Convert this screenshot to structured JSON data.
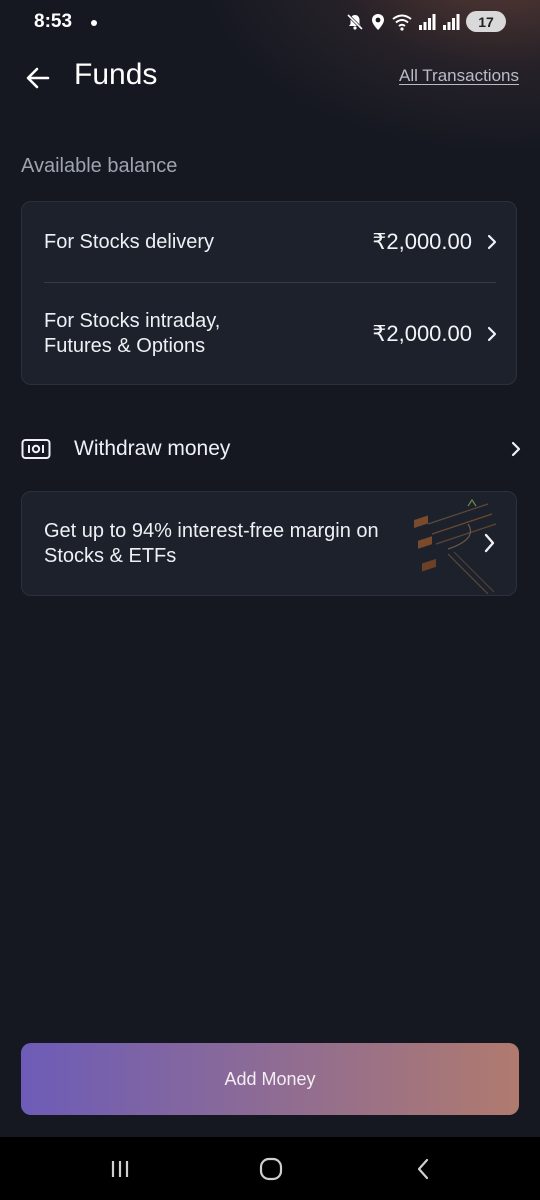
{
  "status_bar": {
    "time": "8:53",
    "battery": "17",
    "icons": [
      "mute-icon",
      "location-icon",
      "wifi-icon",
      "signal-icon",
      "signal-icon",
      "battery-icon"
    ]
  },
  "header": {
    "title": "Funds",
    "all_transactions_label": "All Transactions"
  },
  "available_balance": {
    "label": "Available balance",
    "rows": [
      {
        "label": "For Stocks delivery",
        "amount": "₹2,000.00"
      },
      {
        "label_line1": "For Stocks intraday,",
        "label_line2": "Futures & Options",
        "amount": "₹2,000.00"
      }
    ]
  },
  "withdraw": {
    "label": "Withdraw money",
    "icon": "cash-icon"
  },
  "promo": {
    "line1": "Get up to 94% interest-free margin on",
    "line2": "Stocks & ETFs",
    "icon": "rupee-art-icon"
  },
  "add_money": {
    "label": "Add Money"
  },
  "nav": {
    "icons": [
      "recent-apps-icon",
      "home-icon",
      "back-icon"
    ]
  },
  "colors": {
    "background": "#151821",
    "card": "#1d212b",
    "button_gradient_start": "#6d5cb8",
    "button_gradient_end": "#b07a6e"
  }
}
